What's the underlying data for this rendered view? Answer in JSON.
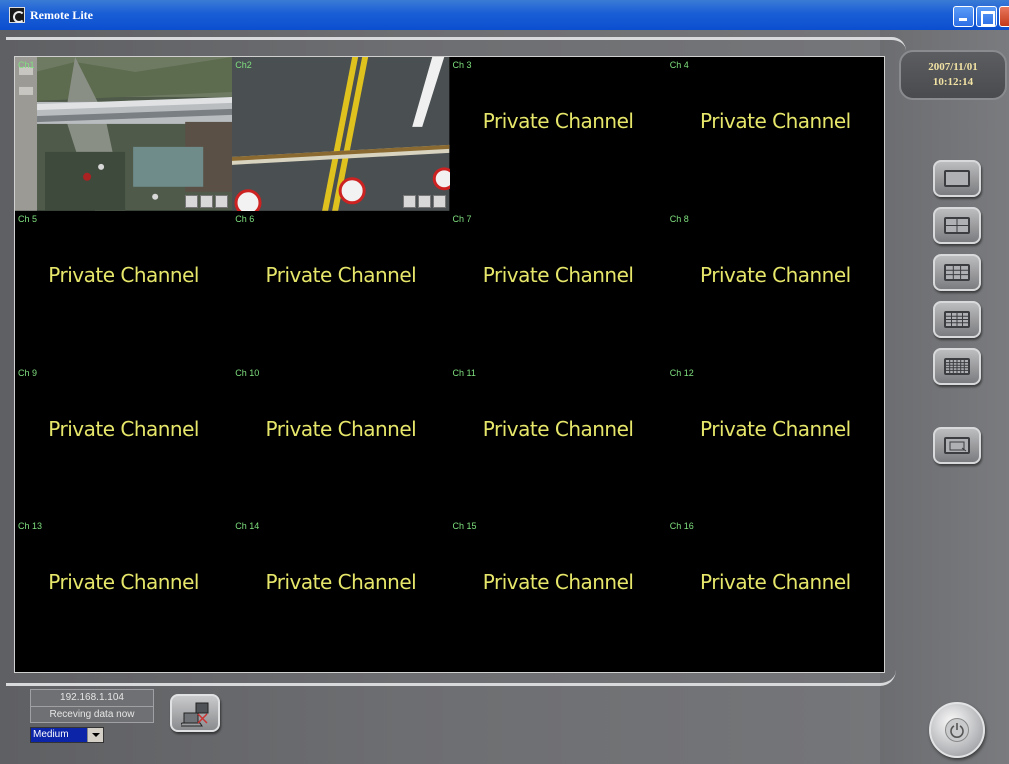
{
  "window": {
    "title": "Remote Lite",
    "icon": "app-logo-icon"
  },
  "clock": {
    "date": "2007/11/01",
    "time": "10:12:14"
  },
  "channels": [
    {
      "label": "Ch1",
      "text": "",
      "live": true
    },
    {
      "label": "Ch2",
      "text": "",
      "live": true
    },
    {
      "label": "Ch 3",
      "text": "Private Channel",
      "live": false
    },
    {
      "label": "Ch 4",
      "text": "Private Channel",
      "live": false
    },
    {
      "label": "Ch 5",
      "text": "Private Channel",
      "live": false
    },
    {
      "label": "Ch 6",
      "text": "Private Channel",
      "live": false
    },
    {
      "label": "Ch 7",
      "text": "Private Channel",
      "live": false
    },
    {
      "label": "Ch 8",
      "text": "Private Channel",
      "live": false
    },
    {
      "label": "Ch 9",
      "text": "Private Channel",
      "live": false
    },
    {
      "label": "Ch 10",
      "text": "Private Channel",
      "live": false
    },
    {
      "label": "Ch 11",
      "text": "Private Channel",
      "live": false
    },
    {
      "label": "Ch 12",
      "text": "Private Channel",
      "live": false
    },
    {
      "label": "Ch 13",
      "text": "Private Channel",
      "live": false
    },
    {
      "label": "Ch 14",
      "text": "Private Channel",
      "live": false
    },
    {
      "label": "Ch 15",
      "text": "Private Channel",
      "live": false
    },
    {
      "label": "Ch 16",
      "text": "Private Channel",
      "live": false
    }
  ],
  "layout_buttons": [
    "single-view-icon",
    "quad-view-icon",
    "nine-view-icon",
    "sixteen-view-icon",
    "full-grid-view-icon",
    "fullscreen-view-icon"
  ],
  "status": {
    "ip": "192.168.1.104",
    "message": "Receving data now"
  },
  "quality": {
    "selected": "Medium"
  },
  "colors": {
    "channel_label": "#7fe07f",
    "private_text": "#e6e66a",
    "clock_text": "#f2e3a4",
    "title_bar": "#1a5ed6"
  }
}
